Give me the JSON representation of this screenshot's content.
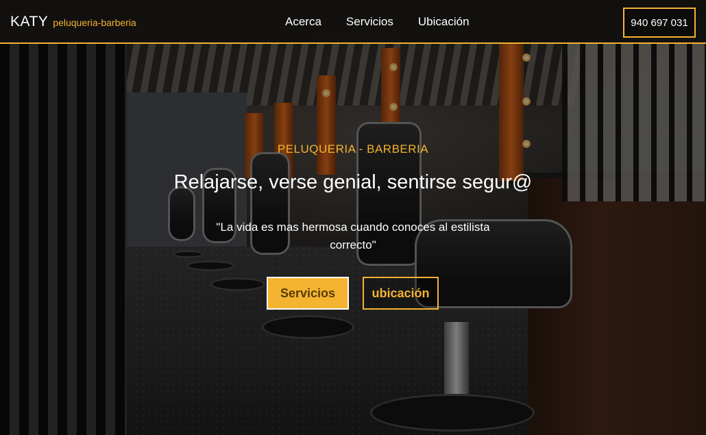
{
  "brand": {
    "name": "KATY",
    "tagline": "peluqueria-barberia"
  },
  "nav": {
    "links": [
      {
        "label": "Acerca"
      },
      {
        "label": "Servicios"
      },
      {
        "label": "Ubicación"
      }
    ],
    "phone": "940 697 031"
  },
  "hero": {
    "kicker": "PELUQUERIA - BARBERIA",
    "headline": "Relajarse, verse genial, sentirse segur@",
    "quote": "\"La vida es mas hermosa cuando conoces al estilista correcto\"",
    "primary_button": "Servicios",
    "secondary_button": "ubicación",
    "background_image": "barbershop-interior-with-chairs"
  },
  "colors": {
    "accent": "#f4b431",
    "text": "#ffffff"
  }
}
